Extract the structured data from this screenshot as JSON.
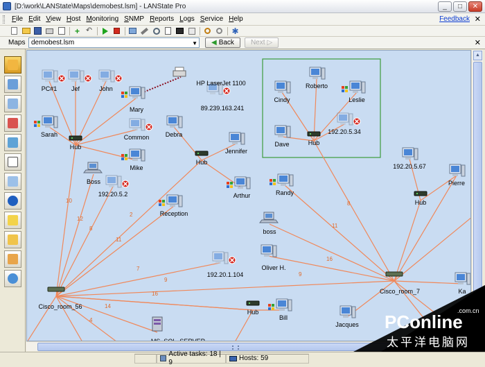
{
  "window": {
    "title": "[D:\\work\\LANState\\Maps\\demobest.lsm] - LANState Pro"
  },
  "menu": {
    "items": [
      "File",
      "Edit",
      "View",
      "Host",
      "Monitoring",
      "SNMP",
      "Reports",
      "Logs",
      "Service",
      "Help"
    ],
    "feedback": "Feedback"
  },
  "addressbar": {
    "label": "Maps",
    "map_file": "demobest.lsm",
    "back_label": "Back",
    "next_label": "Next"
  },
  "map": {
    "group_box_color": "#3c9b3c",
    "link_color": "#f0885a",
    "node_labels": {
      "pc1": "PC#1",
      "jef": "Jef",
      "john": "John",
      "mary": "Mary",
      "hp": "HP LaserJet 1100",
      "ip241": "89.239.163.241",
      "sarah": "Sarah",
      "hub1": "Hub",
      "common": "Common",
      "debra": "Debra",
      "jennifer": "Jennifer",
      "mike": "Mike",
      "hub2": "Hub",
      "boss1": "Boss",
      "ip52": "192.20.5.2",
      "arthur": "Arthur",
      "reception": "Reception",
      "cindy": "Cindy",
      "roberto": "Roberto",
      "leslie": "Leslie",
      "ip534": "192.20.5.34",
      "dave": "Dave",
      "hub3": "Hub",
      "ip567": "192.20.5.67",
      "pierre": "Pierre",
      "hub4": "Hub",
      "randy": "Randy",
      "boss2": "boss",
      "oliver": "Oliver H.",
      "ip1104": "192.20.1.104",
      "cisco56": "Cisco_room_56",
      "cisco7": "Cisco_room_7",
      "hub5": "Hub",
      "bill": "Bill",
      "jacques": "Jacques",
      "kr": "Ka",
      "mssql": "MS_SQL_SERVER"
    },
    "edge_labels": [
      "10",
      "12",
      "8",
      "2",
      "11",
      "7",
      "9",
      "16",
      "14",
      "4",
      "8",
      "11",
      "16",
      "9"
    ]
  },
  "status": {
    "active_tasks": "Active tasks: 18 | 9",
    "hosts": "Hosts: 59"
  },
  "watermark": {
    "brand": "PConline",
    "domain": ".com.cn",
    "chinese": "太平洋电脑网"
  }
}
